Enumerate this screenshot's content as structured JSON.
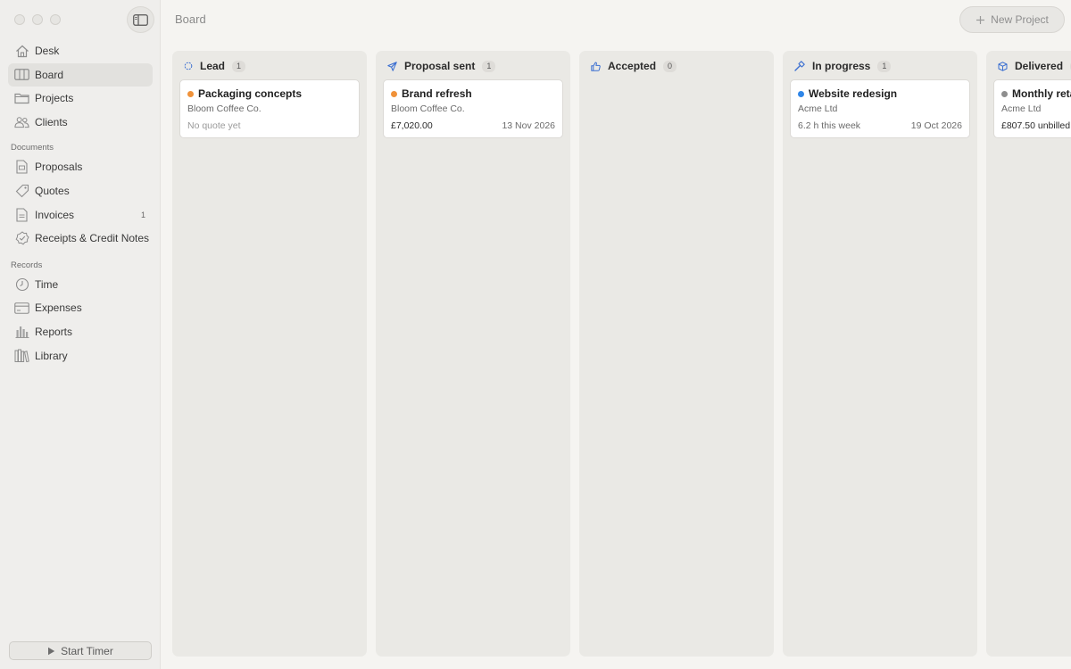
{
  "header": {
    "title": "Board",
    "new_project_label": "New Project"
  },
  "sidebar": {
    "items": [
      {
        "label": "Desk",
        "icon": "house-icon"
      },
      {
        "label": "Board",
        "icon": "board-columns-icon"
      },
      {
        "label": "Projects",
        "icon": "folder-icon"
      },
      {
        "label": "Clients",
        "icon": "people-icon"
      }
    ],
    "sections": [
      {
        "label": "Documents",
        "items": [
          {
            "label": "Proposals",
            "icon": "proposal-document-icon"
          },
          {
            "label": "Quotes",
            "icon": "tag-icon"
          },
          {
            "label": "Invoices",
            "icon": "invoice-document-icon",
            "count": "1"
          },
          {
            "label": "Receipts & Credit Notes",
            "icon": "badge-check-icon"
          }
        ]
      },
      {
        "label": "Records",
        "items": [
          {
            "label": "Time",
            "icon": "clock-icon"
          },
          {
            "label": "Expenses",
            "icon": "credit-card-icon"
          },
          {
            "label": "Reports",
            "icon": "bar-chart-icon"
          },
          {
            "label": "Library",
            "icon": "books-icon"
          }
        ]
      }
    ],
    "timer_label": "Start Timer"
  },
  "colors": {
    "accent_blue": "#3b6fd1",
    "dot_orange": "#f0923a",
    "dot_blue": "#2f86e8",
    "dot_gray": "#8e8e8e"
  },
  "columns": [
    {
      "title": "Lead",
      "count": "1",
      "icon": "circle-outline-icon",
      "cards": [
        {
          "title": "Packaging concepts",
          "client": "Bloom Coffee Co.",
          "left": "No quote yet",
          "right": "",
          "dot": "#f0923a"
        }
      ]
    },
    {
      "title": "Proposal sent",
      "count": "1",
      "icon": "paper-plane-icon",
      "cards": [
        {
          "title": "Brand refresh",
          "client": "Bloom Coffee Co.",
          "left": "£7,020.00",
          "right": "13 Nov 2026",
          "dot": "#f0923a"
        }
      ]
    },
    {
      "title": "Accepted",
      "count": "0",
      "icon": "thumbs-up-icon",
      "cards": []
    },
    {
      "title": "In progress",
      "count": "1",
      "icon": "hammer-icon",
      "cards": [
        {
          "title": "Website redesign",
          "client": "Acme Ltd",
          "left": "6.2 h this week",
          "right": "19 Oct 2026",
          "dot": "#2f86e8"
        }
      ]
    },
    {
      "title": "Delivered",
      "count": "",
      "icon": "box-icon",
      "cards": [
        {
          "title": "Monthly retai",
          "client": "Acme Ltd",
          "left": "£807.50 unbilled",
          "right": "",
          "dot": "#8e8e8e"
        }
      ]
    }
  ]
}
